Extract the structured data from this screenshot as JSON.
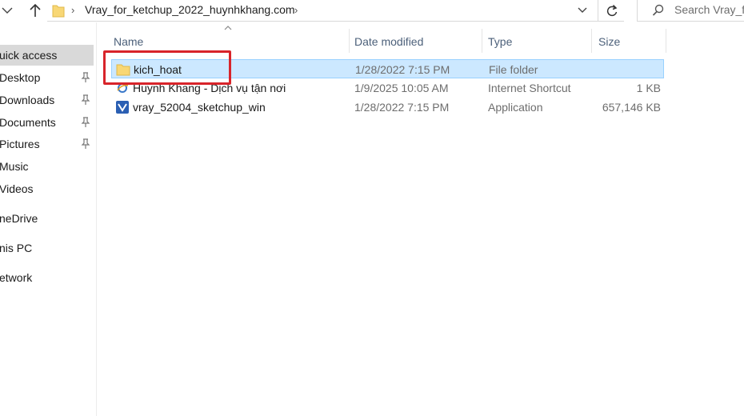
{
  "address_bar": {
    "path_segment": "Vray_for_ketchup_2022_huynhkhang.com",
    "separator": "›"
  },
  "search": {
    "placeholder": "Search Vray_fo"
  },
  "nav_pane": {
    "items": [
      {
        "label": "uick access",
        "pinned": false,
        "selected": true
      },
      {
        "label": "Desktop",
        "pinned": true
      },
      {
        "label": "Downloads",
        "pinned": true
      },
      {
        "label": "Documents",
        "pinned": true
      },
      {
        "label": "Pictures",
        "pinned": true
      },
      {
        "label": "Music",
        "pinned": false
      },
      {
        "label": "Videos",
        "pinned": false
      },
      {
        "label": "neDrive",
        "pinned": false
      },
      {
        "label": "nis PC",
        "pinned": false
      },
      {
        "label": "etwork",
        "pinned": false
      }
    ]
  },
  "columns": {
    "name": "Name",
    "date": "Date modified",
    "type": "Type",
    "size": "Size"
  },
  "files": [
    {
      "name": "kich_hoat",
      "date": "1/28/2022 7:15 PM",
      "type": "File folder",
      "size": "",
      "icon": "folder-icon",
      "selected": true
    },
    {
      "name": "Huynh Khang - Dịch vụ tận nơi",
      "date": "1/9/2025 10:05 AM",
      "type": "Internet Shortcut",
      "size": "1 KB",
      "icon": "internet-shortcut-icon"
    },
    {
      "name": "vray_52004_sketchup_win",
      "date": "1/28/2022 7:15 PM",
      "type": "Application",
      "size": "657,146 KB",
      "icon": "application-icon"
    }
  ],
  "colors": {
    "selection": "#cce8ff",
    "selection_border": "#99d1ff",
    "highlight": "#d8242a",
    "folder": "#f8d775"
  }
}
